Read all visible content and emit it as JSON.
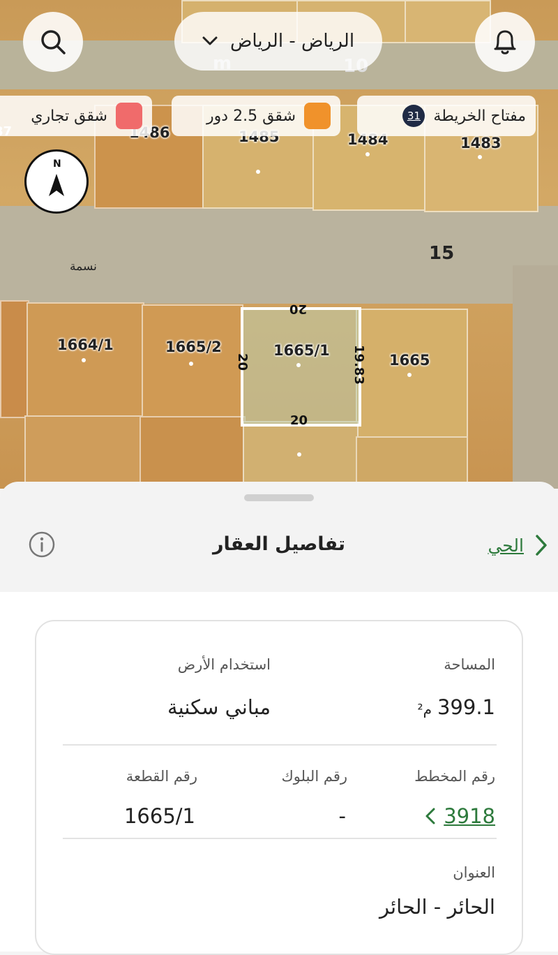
{
  "header": {
    "city_selector": "الرياض - الرياض",
    "search_icon": "search-icon",
    "bell_icon": "bell-icon"
  },
  "legend": {
    "map_key_label": "مفتاح الخريطة",
    "map_key_badge": "31",
    "items": [
      {
        "label": "شقق 2.5 دور",
        "color": "#f0922b"
      },
      {
        "label": "شقق تجاري",
        "color": "#f06b6b"
      }
    ]
  },
  "map": {
    "parcel_labels": [
      "1486",
      "1485",
      "1484",
      "1483",
      "1664/1",
      "1665/2",
      "1665/1",
      "1665"
    ],
    "street_number": "15",
    "street_name": "نسمة",
    "selected_dims": {
      "top": "20",
      "left": "20",
      "right": "19.83",
      "bottom": "20"
    },
    "overlay_fragments": [
      "m",
      "10",
      "87"
    ],
    "compass_letter": "N"
  },
  "sheet": {
    "back_link": "الحي",
    "title": "تفاصيل العقار",
    "info_icon": "info-icon"
  },
  "details": {
    "area_label": "المساحة",
    "area_value": "399.1",
    "area_unit": "م²",
    "land_use_label": "استخدام الأرض",
    "land_use_value": "مباني سكنية",
    "plan_label": "رقم المخطط",
    "plan_value": "3918",
    "block_label": "رقم البلوك",
    "block_value": "-",
    "plot_label": "رقم القطعة",
    "plot_value": "1665/1",
    "address_label": "العنوان",
    "address_value": "الحائر - الحائر"
  },
  "colors": {
    "accent_green": "#2d7a3c",
    "badge_navy": "#1f2a44"
  }
}
